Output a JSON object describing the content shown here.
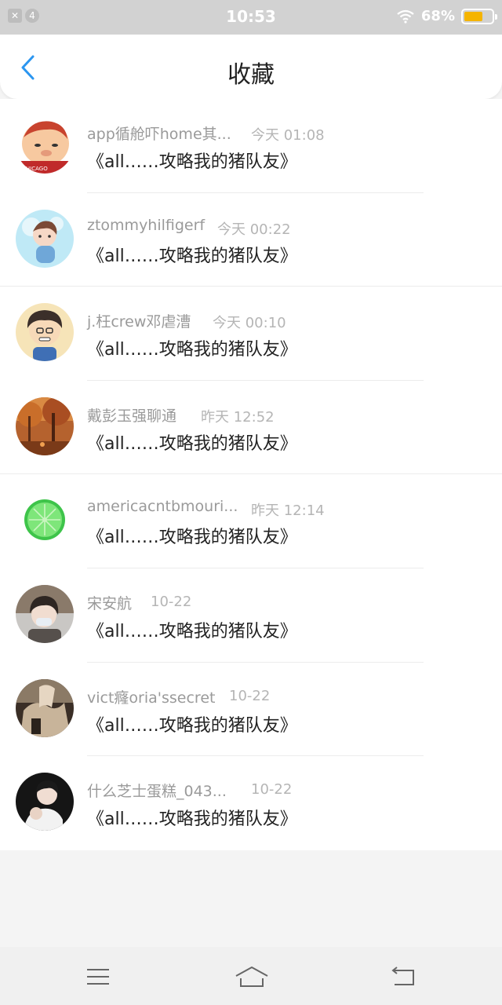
{
  "status_bar": {
    "notif_count": "4",
    "time": "10:53",
    "battery_percent": "68%",
    "battery_level": 0.68,
    "battery_color": "#f5b400"
  },
  "header": {
    "title": "收藏",
    "back_icon": "chevron-left-icon",
    "accent_color": "#2b96f0"
  },
  "items": [
    {
      "name": "app循舱吓home其...",
      "time": "今天 01:08",
      "message": "《all……攻略我的猪队友》"
    },
    {
      "name": "ztommyhilfigerf",
      "time": "今天 00:22",
      "message": "《all……攻略我的猪队友》"
    },
    {
      "name": "j.枉crew邓虐漕",
      "time": "今天 00:10",
      "message": "《all……攻略我的猪队友》"
    },
    {
      "name": "戴彭玉强聊通",
      "time": "昨天 12:52",
      "message": "《all……攻略我的猪队友》"
    },
    {
      "name": "americacntbmouri...",
      "time": "昨天 12:14",
      "message": "《all……攻略我的猪队友》"
    },
    {
      "name": "宋安航",
      "time": "10-22",
      "message": "《all……攻略我的猪队友》"
    },
    {
      "name": "vict癃oria'ssecret",
      "time": "10-22",
      "message": "《all……攻略我的猪队友》"
    },
    {
      "name": "什么芝士蛋糕_043...",
      "time": "10-22",
      "message": "《all……攻略我的猪队友》"
    }
  ],
  "nav_bar": {
    "menu_icon": "menu-icon",
    "home_icon": "home-icon",
    "back_icon": "back-arrow-icon"
  }
}
